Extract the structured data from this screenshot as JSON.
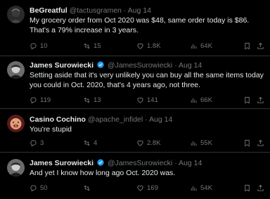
{
  "tweets": [
    {
      "name": "BeGreatful",
      "handle": "@tactusgramen",
      "sep": "·",
      "date": "Aug 14",
      "verified": false,
      "text": "My grocery order from Oct 2020 was $48, same order today is $86. That's a 79% increase in 3 years.",
      "replies": "10",
      "reposts": "15",
      "likes": "1.8K",
      "views": "64K"
    },
    {
      "name": "James Surowiecki",
      "handle": "@JamesSurowiecki",
      "sep": "·",
      "date": "Aug 14",
      "verified": true,
      "text": "Setting aside that it's very unlikely you can buy all the same items today you could in Oct. 2020, that's 4 years ago, not three.",
      "replies": "119",
      "reposts": "13",
      "likes": "141",
      "views": "66K"
    },
    {
      "name": "Casino Cochino",
      "handle": "@apache_infidel",
      "sep": "·",
      "date": "Aug 14",
      "verified": false,
      "text": "You're stupid",
      "replies": "3",
      "reposts": "4",
      "likes": "2.8K",
      "views": "55K"
    },
    {
      "name": "James Surowiecki",
      "handle": "@JamesSurowiecki",
      "sep": "·",
      "date": "Aug 14",
      "verified": true,
      "text": "And yet I know how long ago Oct. 2020 was.",
      "replies": "50",
      "reposts": "",
      "likes": "169",
      "views": "54K"
    }
  ],
  "colors": {
    "background": "#000000",
    "text": "#e7e9ea",
    "secondary": "#71767b",
    "verified": "#1d9bf0",
    "divider": "#2f3336"
  }
}
